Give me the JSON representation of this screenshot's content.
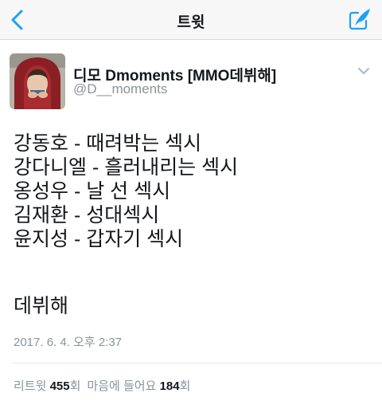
{
  "navbar": {
    "title": "트윗",
    "back_icon": "chevron-left-icon",
    "compose_icon": "compose-tweet-icon",
    "accent_color": "#1da1f2"
  },
  "author": {
    "display_name": "디모 Dmoments [MMO데뷔해]",
    "handle": "@D__moments",
    "avatar": "profile-photo"
  },
  "tweet": {
    "lines": [
      "강동호 - 때려박는 섹시",
      "강다니엘 - 흘러내리는 섹시",
      "옹성우 - 날 선 섹시",
      "김재환 - 성대섹시",
      "윤지성 - 갑자기 섹시"
    ],
    "closing": "데뷔해",
    "timestamp": "2017. 6. 4. 오후 2:37"
  },
  "stats": {
    "retweets_label": "리트윗",
    "retweets_count": "455",
    "retweets_unit": "회",
    "likes_label": "마음에 들어요",
    "likes_count": "184",
    "likes_unit": "회"
  }
}
